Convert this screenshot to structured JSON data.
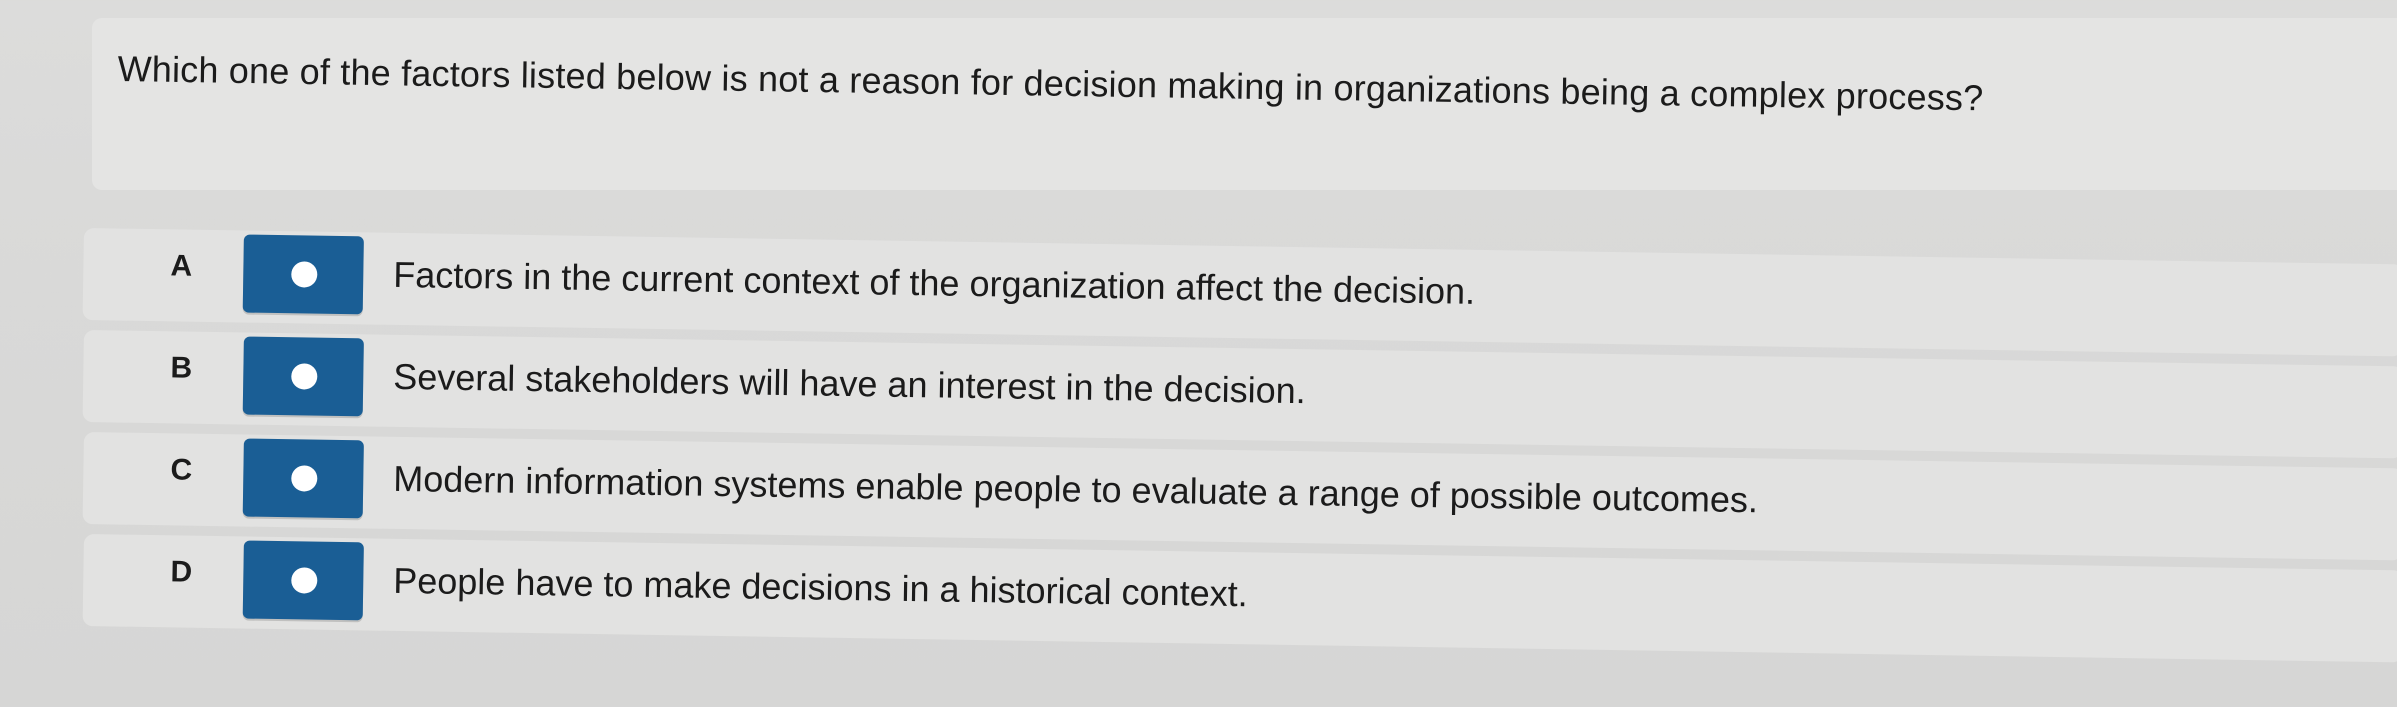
{
  "question": {
    "text": "Which one of the factors listed below is not a reason for decision making in organizations being a complex process?"
  },
  "options": [
    {
      "letter": "A",
      "text": "Factors in the current context of the organization affect the decision."
    },
    {
      "letter": "B",
      "text": "Several stakeholders will have an interest in the decision."
    },
    {
      "letter": "C",
      "text": "Modern information systems enable people to evaluate a range of possible outcomes."
    },
    {
      "letter": "D",
      "text": "People have to make decisions in a historical context."
    }
  ],
  "colors": {
    "radio_box": "#1a5e95",
    "radio_dot": "#ffffff",
    "background": "#d9d9d8",
    "row_background": "#e2e2e1"
  }
}
